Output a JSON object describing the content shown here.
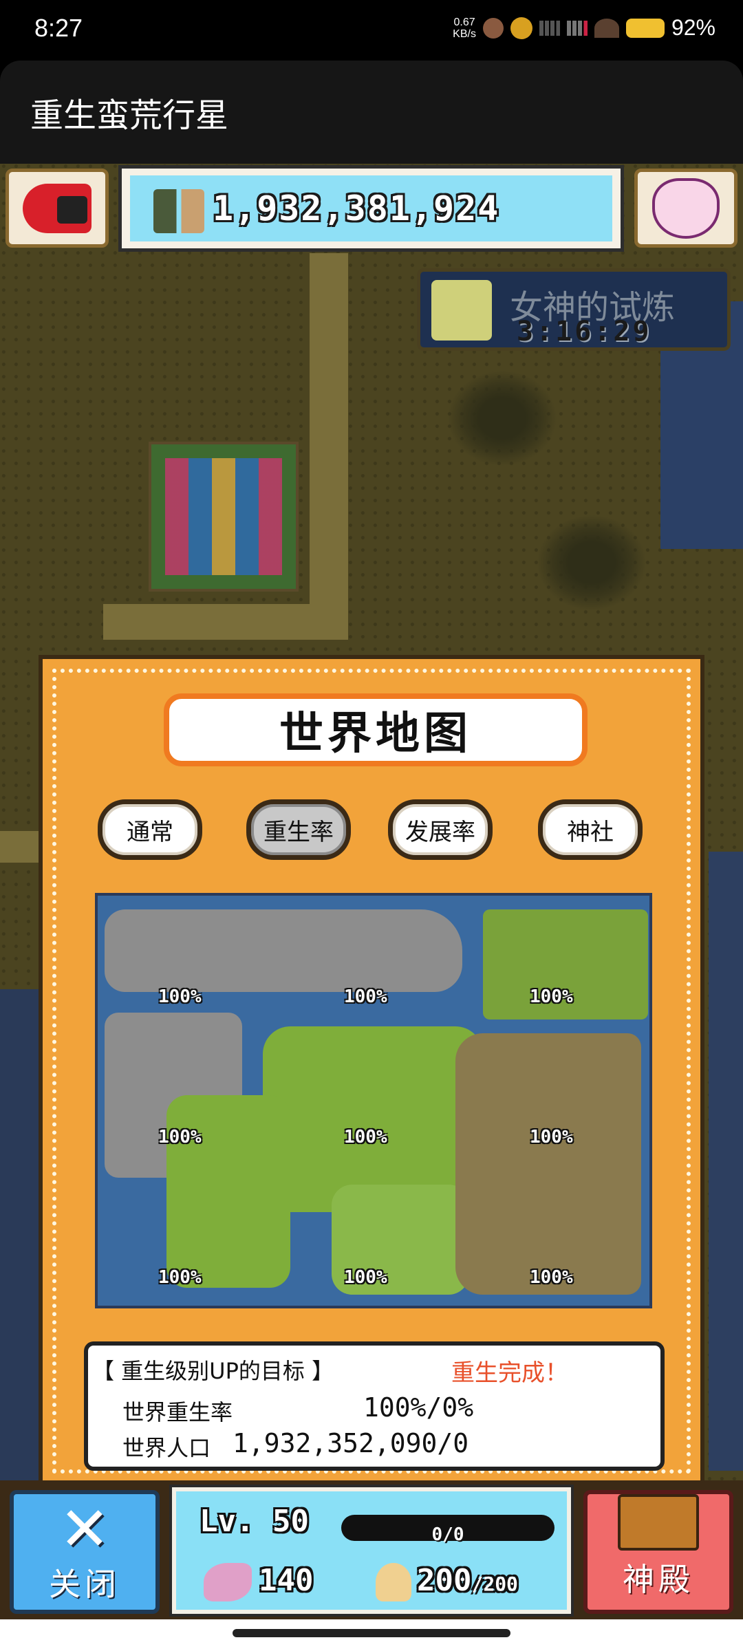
{
  "statusbar": {
    "time": "8:27",
    "speed_value": "0.67",
    "speed_unit": "KB/s",
    "battery": "92%"
  },
  "app": {
    "title": "重生蛮荒行星"
  },
  "top": {
    "population": "1,932,381,924",
    "goddess_label": "女神的试炼",
    "goddess_timer": "3:16:29",
    "camera_icon": "camera-icon",
    "bunny_icon": "bunny-mask-icon"
  },
  "panel": {
    "title": "世界地图",
    "tabs": [
      {
        "label": "通常",
        "active": false
      },
      {
        "label": "重生率",
        "active": true
      },
      {
        "label": "发展率",
        "active": false
      },
      {
        "label": "神社",
        "active": false
      }
    ],
    "regions": [
      {
        "pct": "100%"
      },
      {
        "pct": "100%"
      },
      {
        "pct": "100%"
      },
      {
        "pct": "100%"
      },
      {
        "pct": "100%"
      },
      {
        "pct": "100%"
      },
      {
        "pct": "100%"
      },
      {
        "pct": "100%"
      },
      {
        "pct": "100%"
      }
    ],
    "goal": {
      "header": "【 重生级别UP的目标 】",
      "status": "重生完成！",
      "row1_label": "世界重生率",
      "row1_value": "100%/0%",
      "row2_label": "世界人口",
      "row2_value": "1,932,352,090/0"
    }
  },
  "bottom": {
    "close_label": "关闭",
    "close_glyph": "✕",
    "level": "Lv. 50",
    "xp": "0/0",
    "stat1": "140",
    "stat2": "200",
    "stat2_max": "/200",
    "temple_label": "神殿"
  },
  "colors": {
    "panel": "#f2a33a",
    "title_border": "#f07a20",
    "status_panel": "#8ae0f6",
    "close_btn": "#4fb0f0",
    "temple_btn": "#f06a6a",
    "done_text": "#e8502a"
  }
}
